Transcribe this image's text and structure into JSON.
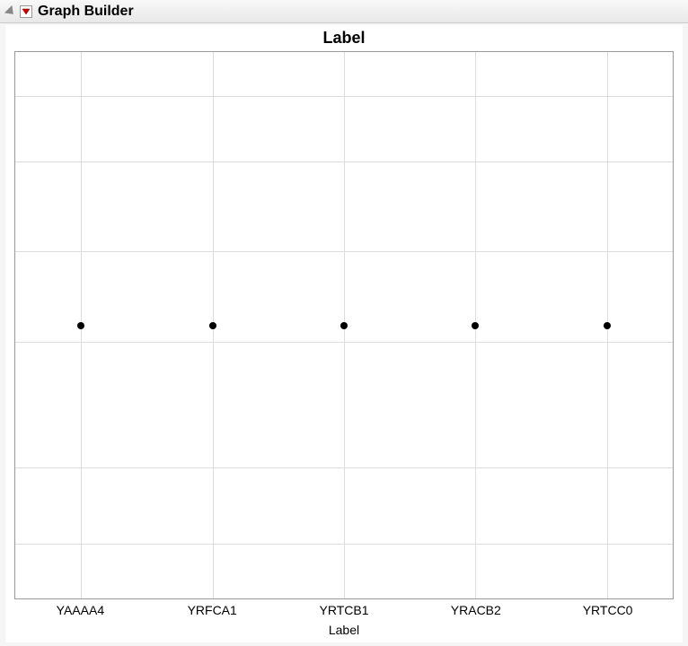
{
  "header": {
    "title": "Graph Builder"
  },
  "chart_data": {
    "type": "scatter",
    "title": "Label",
    "xlabel": "Label",
    "ylabel": "",
    "categories": [
      "YAAAA4",
      "YRFCA1",
      "YRTCB1",
      "YRACB2",
      "YRTCC0"
    ],
    "values": [
      0.5,
      0.5,
      0.5,
      0.5,
      0.5
    ],
    "ylim": [
      0,
      1
    ],
    "grid": {
      "horizontal_lines": 6,
      "vertical_lines": 5
    }
  }
}
